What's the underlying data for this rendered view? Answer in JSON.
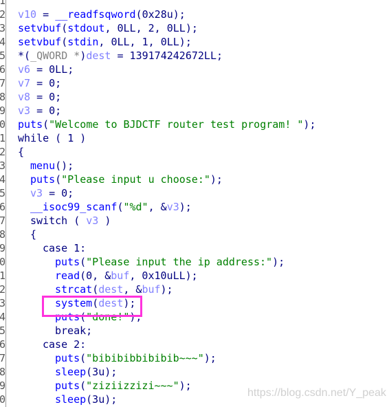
{
  "line_numbers": [
    "1",
    "2",
    "3",
    "4",
    "5",
    "6",
    "7",
    "8",
    "9",
    "0",
    "1",
    "2",
    "3",
    "4",
    "5",
    "6",
    "7",
    "8",
    "9",
    "0",
    "1",
    "2",
    "3",
    "4",
    "5",
    "6",
    "7",
    "8",
    "9",
    "0"
  ],
  "code_lines": [
    {
      "indent": 0,
      "tokens": []
    },
    {
      "indent": 0,
      "tokens": [
        [
          "var",
          "v10"
        ],
        [
          "pun",
          " = "
        ],
        [
          "fn",
          "__readfsqword"
        ],
        [
          "pun",
          "(0x28u);"
        ]
      ]
    },
    {
      "indent": 0,
      "tokens": [
        [
          "fn",
          "setvbuf"
        ],
        [
          "pun",
          "("
        ],
        [
          "fn",
          "stdout"
        ],
        [
          "pun",
          ", 0LL, 2, 0LL);"
        ]
      ]
    },
    {
      "indent": 0,
      "tokens": [
        [
          "fn",
          "setvbuf"
        ],
        [
          "pun",
          "("
        ],
        [
          "fn",
          "stdin"
        ],
        [
          "pun",
          ", 0LL, 1, 0LL);"
        ]
      ]
    },
    {
      "indent": 0,
      "tokens": [
        [
          "pun",
          "*("
        ],
        [
          "gray",
          "_QWORD *"
        ],
        [
          "pun",
          ")"
        ],
        [
          "var",
          "dest"
        ],
        [
          "pun",
          " = 139174242672LL;"
        ]
      ]
    },
    {
      "indent": 0,
      "tokens": [
        [
          "var",
          "v6"
        ],
        [
          "pun",
          " = 0LL;"
        ]
      ]
    },
    {
      "indent": 0,
      "tokens": [
        [
          "var",
          "v7"
        ],
        [
          "pun",
          " = 0;"
        ]
      ]
    },
    {
      "indent": 0,
      "tokens": [
        [
          "var",
          "v8"
        ],
        [
          "pun",
          " = 0;"
        ]
      ]
    },
    {
      "indent": 0,
      "tokens": [
        [
          "var",
          "v3"
        ],
        [
          "pun",
          " = 0;"
        ]
      ]
    },
    {
      "indent": 0,
      "tokens": [
        [
          "fn",
          "puts"
        ],
        [
          "pun",
          "("
        ],
        [
          "str",
          "\"Welcome to BJDCTF router test program! \""
        ],
        [
          "pun",
          ");"
        ]
      ]
    },
    {
      "indent": 0,
      "tokens": [
        [
          "pun",
          "while ( 1 )"
        ]
      ]
    },
    {
      "indent": 0,
      "tokens": [
        [
          "pun",
          "{"
        ]
      ]
    },
    {
      "indent": 2,
      "tokens": [
        [
          "fn",
          "menu"
        ],
        [
          "pun",
          "();"
        ]
      ]
    },
    {
      "indent": 2,
      "tokens": [
        [
          "fn",
          "puts"
        ],
        [
          "pun",
          "("
        ],
        [
          "str",
          "\"Please input u choose:\""
        ],
        [
          "pun",
          ");"
        ]
      ]
    },
    {
      "indent": 2,
      "tokens": [
        [
          "var",
          "v3"
        ],
        [
          "pun",
          " = 0;"
        ]
      ]
    },
    {
      "indent": 2,
      "tokens": [
        [
          "fn",
          "__isoc99_scanf"
        ],
        [
          "pun",
          "("
        ],
        [
          "str",
          "\"%d\""
        ],
        [
          "pun",
          ", &"
        ],
        [
          "var",
          "v3"
        ],
        [
          "pun",
          ");"
        ]
      ]
    },
    {
      "indent": 2,
      "tokens": [
        [
          "pun",
          "switch ( "
        ],
        [
          "var",
          "v3"
        ],
        [
          "pun",
          " )"
        ]
      ]
    },
    {
      "indent": 2,
      "tokens": [
        [
          "pun",
          "{"
        ]
      ]
    },
    {
      "indent": 4,
      "tokens": [
        [
          "pun",
          "case 1:"
        ]
      ]
    },
    {
      "indent": 6,
      "tokens": [
        [
          "fn",
          "puts"
        ],
        [
          "pun",
          "("
        ],
        [
          "str",
          "\"Please input the ip address:\""
        ],
        [
          "pun",
          ");"
        ]
      ]
    },
    {
      "indent": 6,
      "tokens": [
        [
          "fn",
          "read"
        ],
        [
          "pun",
          "(0, &"
        ],
        [
          "var",
          "buf"
        ],
        [
          "pun",
          ", 0x10uLL);"
        ]
      ]
    },
    {
      "indent": 6,
      "tokens": [
        [
          "fn",
          "strcat"
        ],
        [
          "pun",
          "("
        ],
        [
          "var",
          "dest"
        ],
        [
          "pun",
          ", &"
        ],
        [
          "var",
          "buf"
        ],
        [
          "pun",
          ");"
        ]
      ]
    },
    {
      "indent": 6,
      "tokens": [
        [
          "fn",
          "system"
        ],
        [
          "pun",
          "("
        ],
        [
          "var",
          "dest"
        ],
        [
          "pun",
          ");"
        ]
      ]
    },
    {
      "indent": 6,
      "tokens": [
        [
          "fn",
          "puts"
        ],
        [
          "pun",
          "("
        ],
        [
          "str",
          "\"done!\""
        ],
        [
          "pun",
          ");"
        ]
      ]
    },
    {
      "indent": 6,
      "tokens": [
        [
          "pun",
          "break;"
        ]
      ]
    },
    {
      "indent": 4,
      "tokens": [
        [
          "pun",
          "case 2:"
        ]
      ]
    },
    {
      "indent": 6,
      "tokens": [
        [
          "fn",
          "puts"
        ],
        [
          "pun",
          "("
        ],
        [
          "str",
          "\"bibibibbibibib~~~\""
        ],
        [
          "pun",
          ");"
        ]
      ]
    },
    {
      "indent": 6,
      "tokens": [
        [
          "fn",
          "sleep"
        ],
        [
          "pun",
          "(3u);"
        ]
      ]
    },
    {
      "indent": 6,
      "tokens": [
        [
          "fn",
          "puts"
        ],
        [
          "pun",
          "("
        ],
        [
          "str",
          "\"ziziizzizi~~~\""
        ],
        [
          "pun",
          ");"
        ]
      ]
    },
    {
      "indent": 6,
      "tokens": [
        [
          "fn",
          "sleep"
        ],
        [
          "pun",
          "(3u);"
        ]
      ]
    }
  ],
  "highlight_color": "#ff33dd",
  "watermark": "https://blog.csdn.net/Y_peak"
}
